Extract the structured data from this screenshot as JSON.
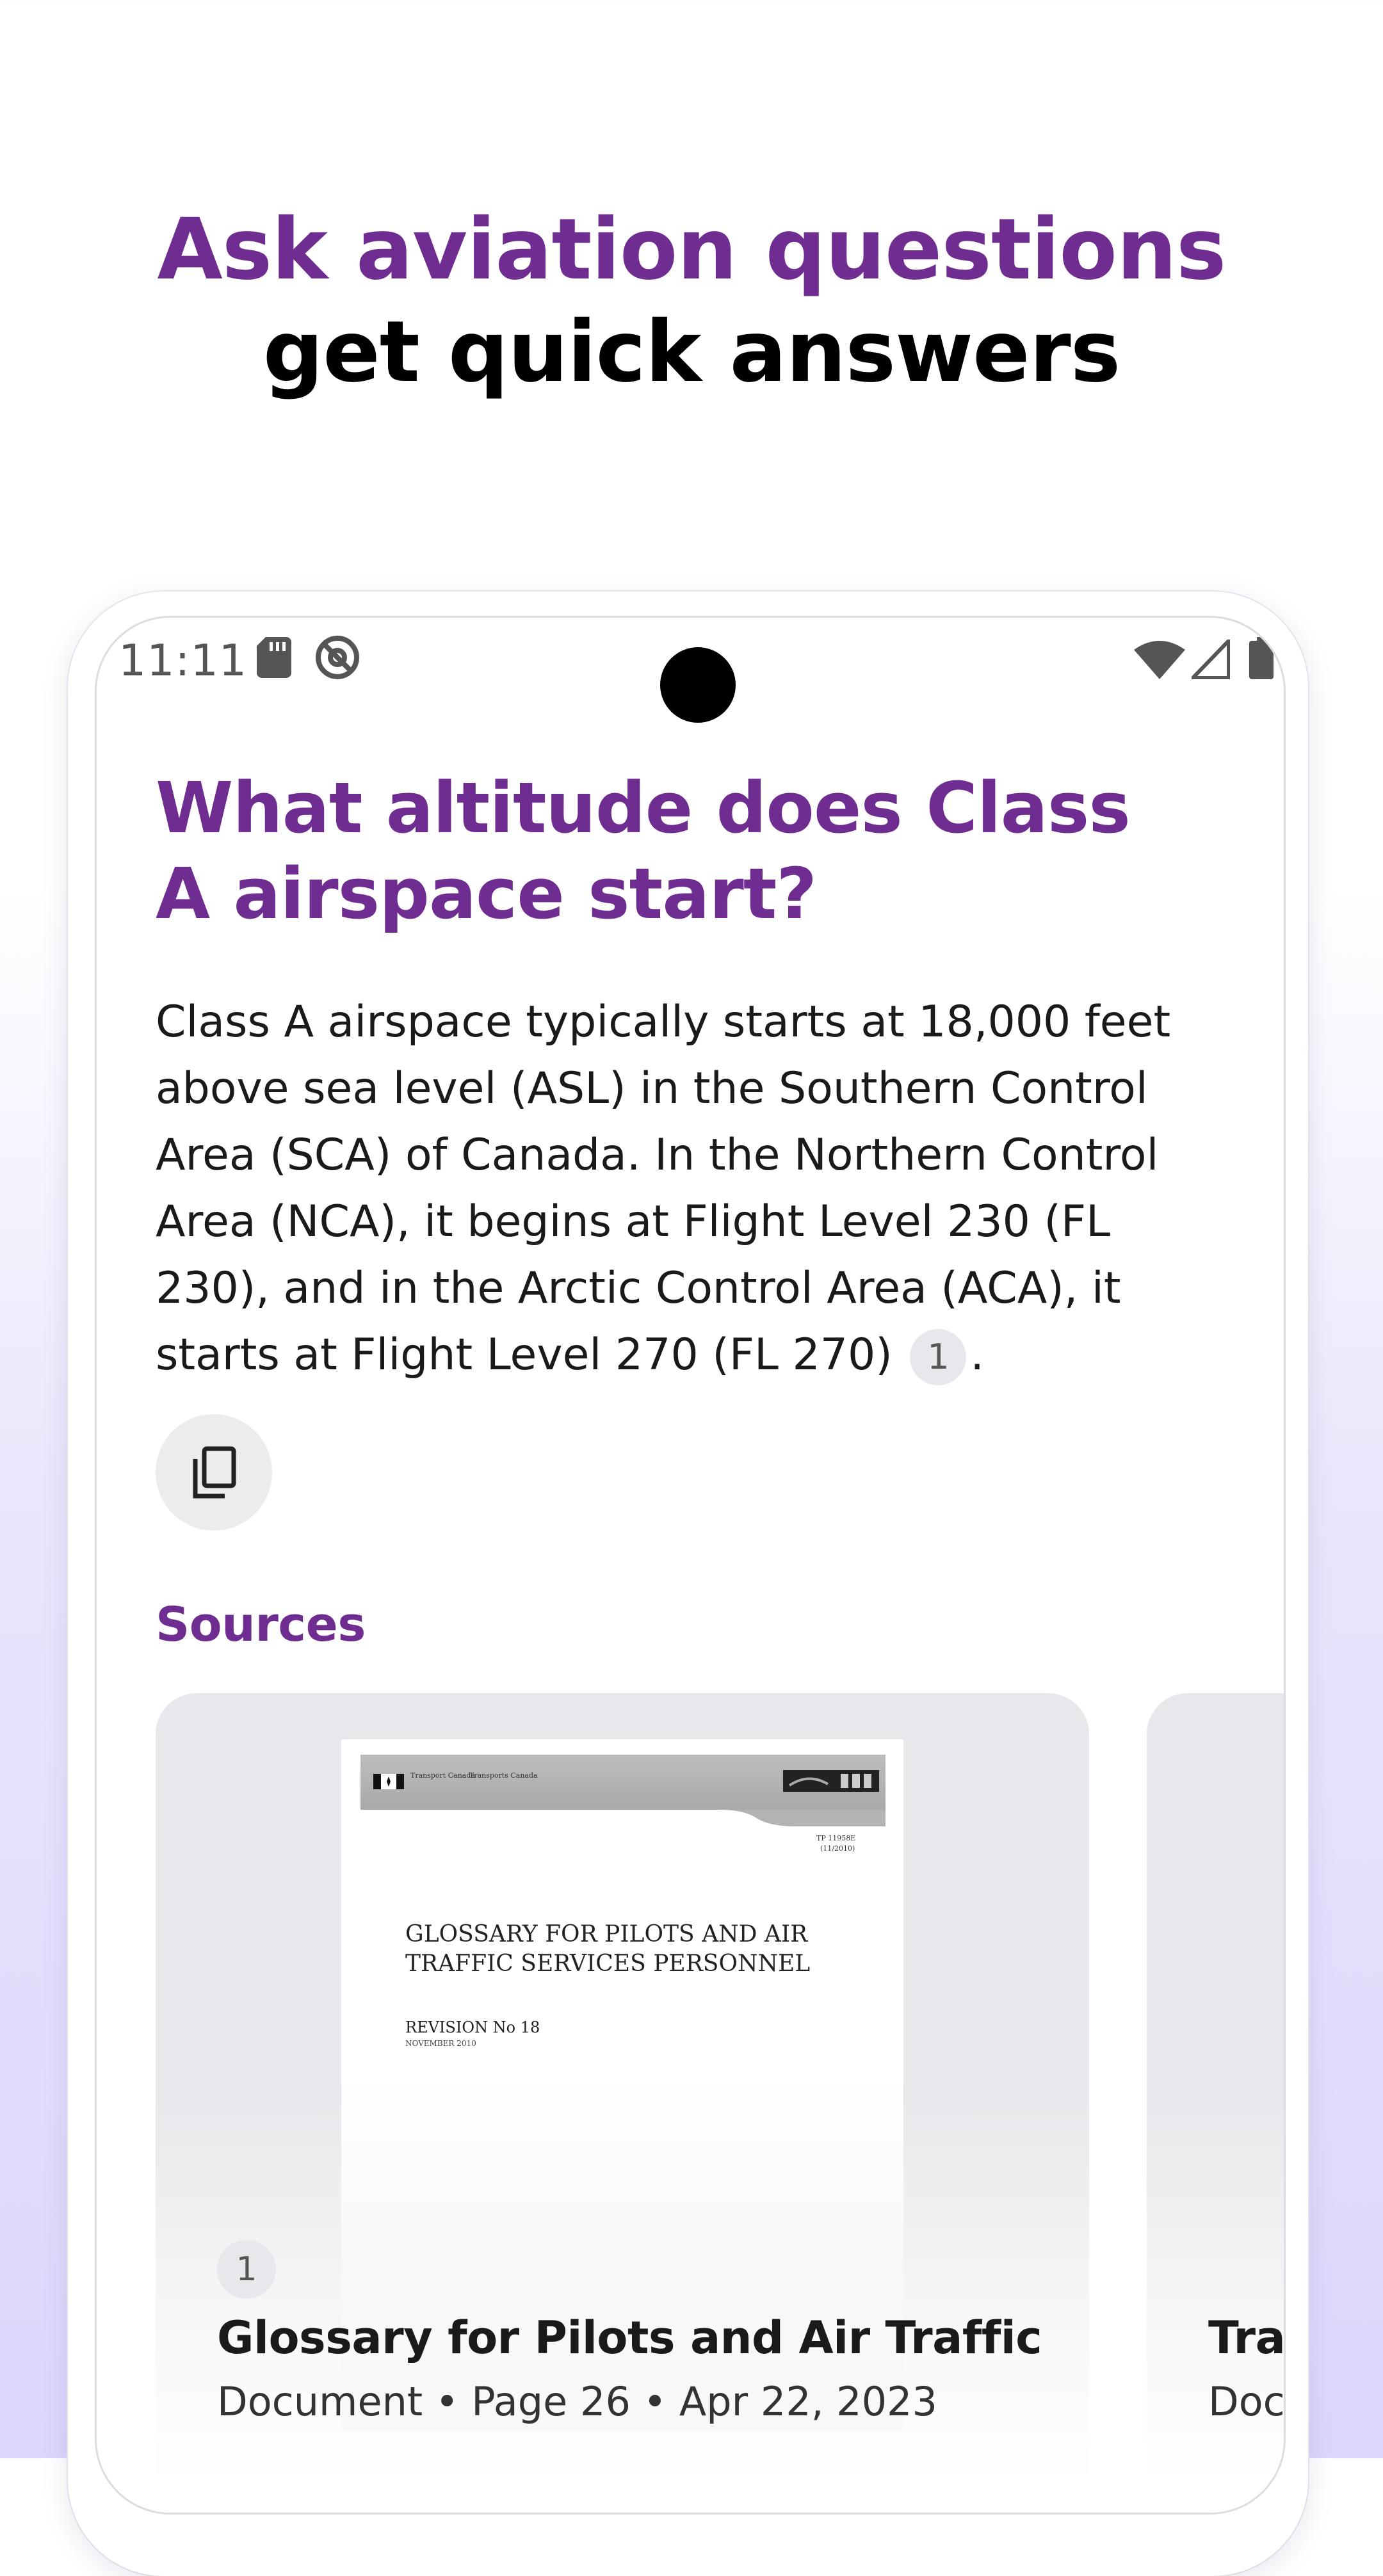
{
  "headline": {
    "line1": "Ask aviation questions",
    "line2": "get quick answers"
  },
  "status_bar": {
    "time": "11:11",
    "icons": [
      "sd-card-icon",
      "at-sign-icon",
      "wifi-icon",
      "signal-icon",
      "battery-icon"
    ]
  },
  "question": "What altitude does Class A airspace start?",
  "answer": {
    "text": "Class A airspace typically starts at 18,000 feet above sea level (ASL) in the Southern Control Area (SCA) of Canada. In the Northern Control Area (NCA), it begins at Flight Level 230 (FL 230), and in the Arctic Control Area (ACA), it starts at Flight Level 270 (FL 270)",
    "citation": "1",
    "end": "."
  },
  "copy_button": {
    "icon": "copy-icon"
  },
  "sources": {
    "label": "Sources",
    "cards": [
      {
        "badge": "1",
        "title": "Glossary for Pilots and Air Traffic ...",
        "meta": "Document • Page 26 • Apr 22, 2023",
        "thumbnail": {
          "header_left": "Transport Canada",
          "header_right": "Transports Canada",
          "doc_number": "TP 11958E",
          "doc_date_code": "(11/2010)",
          "title": "GLOSSARY FOR PILOTS AND AIR TRAFFIC SERVICES PERSONNEL",
          "revision": "REVISION No 18",
          "revision_date": "NOVEMBER 2010"
        }
      },
      {
        "title": "Tran",
        "meta": "Docu"
      }
    ]
  },
  "colors": {
    "accent": "#6f2c91",
    "background_gradient_end": "#dcd5fd"
  }
}
